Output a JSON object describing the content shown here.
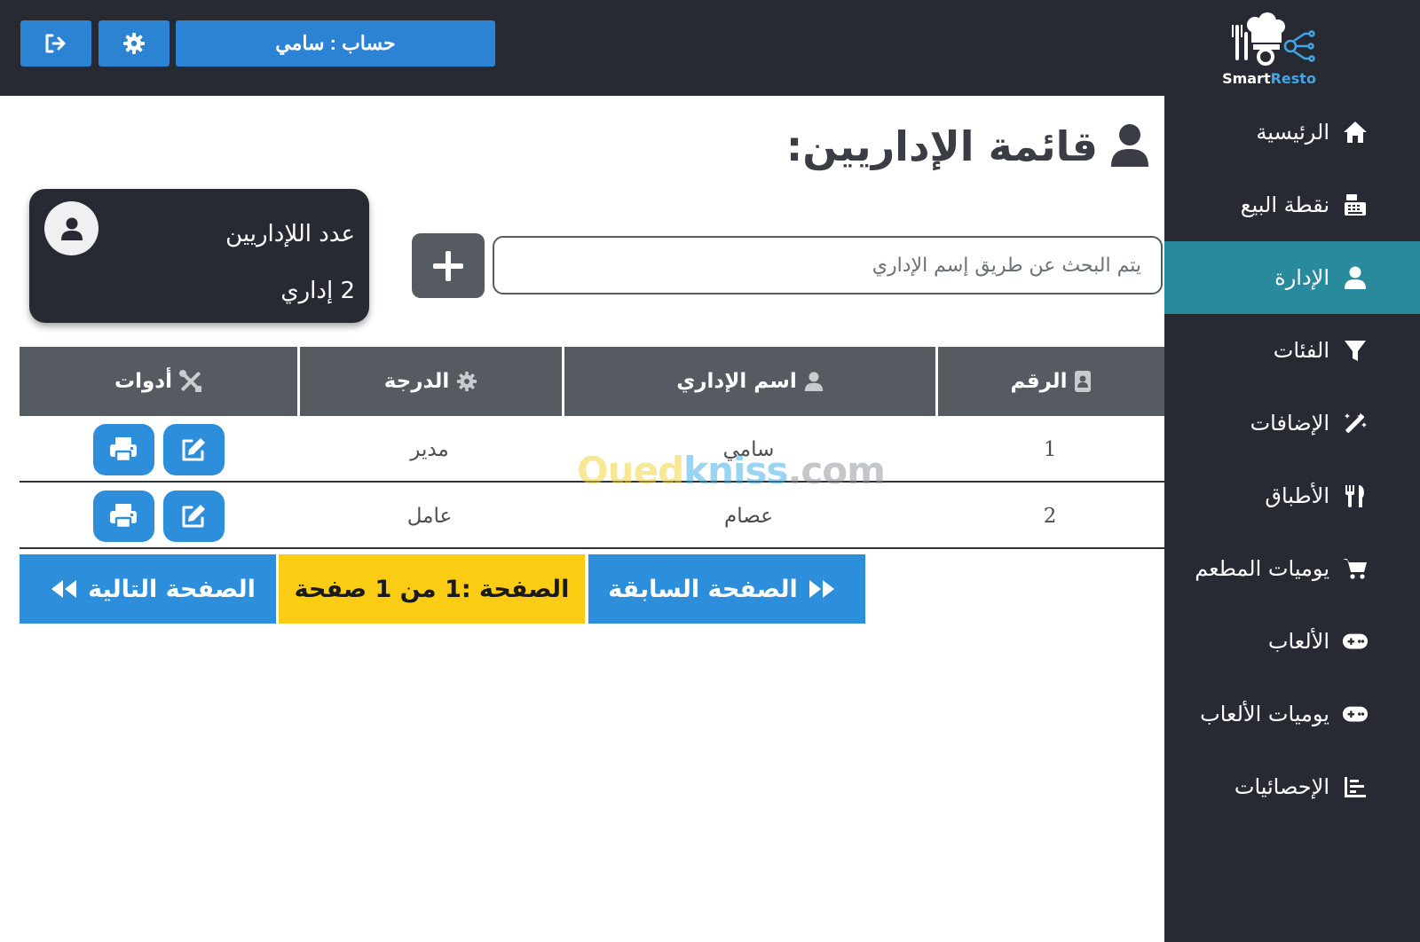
{
  "header": {
    "account_label": "حساب : سامي",
    "logo_text_a": "Smart",
    "logo_text_b": "Resto"
  },
  "sidebar": {
    "items": [
      {
        "label": "الرئيسية",
        "icon": "home-icon"
      },
      {
        "label": "نقطة البيع",
        "icon": "cash-register-icon"
      },
      {
        "label": "الإدارة",
        "icon": "user-icon",
        "active": true
      },
      {
        "label": "الفئات",
        "icon": "filter-icon"
      },
      {
        "label": "الإضافات",
        "icon": "magic-wand-icon"
      },
      {
        "label": "الأطباق",
        "icon": "utensils-icon"
      },
      {
        "label": "يوميات المطعم",
        "icon": "cart-icon"
      },
      {
        "label": "الألعاب",
        "icon": "gamepad-icon"
      },
      {
        "label": "يوميات الألعاب",
        "icon": "gamepad-icon"
      },
      {
        "label": "الإحصائيات",
        "icon": "chart-icon"
      }
    ]
  },
  "main": {
    "title": "قائمة الإداريين:",
    "search_placeholder": "يتم البحث عن طريق إسم الإداري",
    "count_card": {
      "title": "عدد اللإداريين",
      "value": "2 إداري"
    },
    "table": {
      "headers": {
        "number": "الرقم",
        "name": "اسم الإداري",
        "grade": "الدرجة",
        "tools": "أدوات"
      },
      "rows": [
        {
          "number": "1",
          "name": "سامي",
          "grade": "مدير"
        },
        {
          "number": "2",
          "name": "عصام",
          "grade": "عامل"
        }
      ]
    },
    "watermark": {
      "a": "Oued",
      "b": "kniss",
      "c": ".com"
    },
    "pagination": {
      "next": "الصفحة التالية",
      "info": "الصفحة :1 من 1 صفحة",
      "prev": "الصفحة السابقة"
    }
  },
  "colors": {
    "dark_bg": "#272a33",
    "accent_blue": "#2d8fdc",
    "active_teal": "#2a8a9d",
    "header_gray": "#565a61",
    "page_yellow": "#fbcc14"
  }
}
